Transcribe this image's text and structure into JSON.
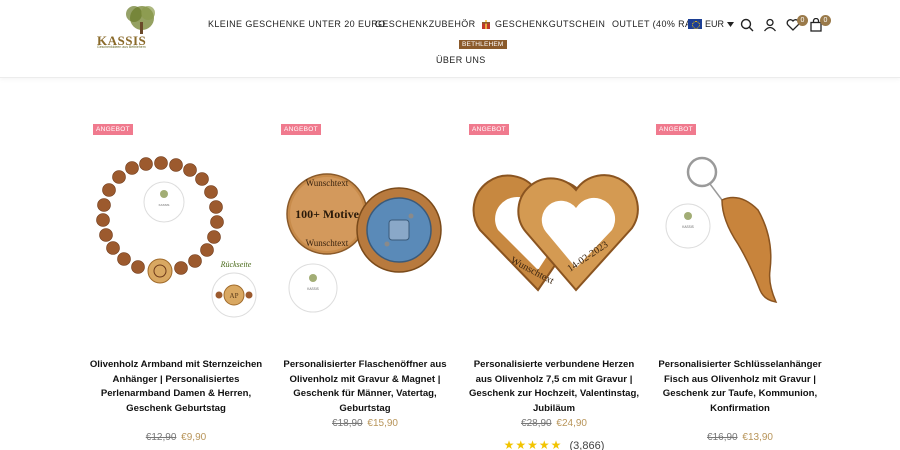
{
  "header": {
    "logo_text": "KASSIS",
    "logo_tagline": "Geschenkideen aus Bethlehem",
    "nav": [
      {
        "label": "KLEINE GESCHENKE UNTER 20 EURO"
      },
      {
        "label": "GESCHENKZUBEHÖR"
      },
      {
        "label": "GESCHENKGUTSCHEIN"
      },
      {
        "label": "OUTLET (40% RABATT)"
      },
      {
        "label": "ÜBER UNS"
      }
    ],
    "bethlehem_badge": "BETHLEHEM",
    "currency": "EUR",
    "wishlist_count": "0",
    "cart_count": "0",
    "icons": [
      "eu-flag-icon",
      "chevron-down-icon",
      "search-icon",
      "user-icon",
      "heart-icon",
      "bag-icon",
      "gift-icon"
    ]
  },
  "products": [
    {
      "badge": "ANGEBOT",
      "title": "Olivenholz Armband mit Sternzeichen Anhänger | Personalisiertes Perlenarmband Damen & Herren, Geschenk Geburtstag",
      "old_price": "€12,90",
      "new_price": "€9,90",
      "image_label": "Rückseite"
    },
    {
      "badge": "ANGEBOT",
      "title": "Personalisierter Flaschenöffner aus Olivenholz mit Gravur & Magnet | Geschenk für Männer, Vatertag, Geburtstag",
      "old_price": "€18,90",
      "new_price": "€15,90",
      "image_text_top": "Wunschtext",
      "image_text_mid": "100+ Motive",
      "image_text_bottom": "Wunschtext"
    },
    {
      "badge": "ANGEBOT",
      "title": "Personalisierte verbundene Herzen aus Olivenholz 7,5 cm mit Gravur | Geschenk zur Hochzeit, Valentinstag, Jubiläum",
      "old_price": "€28,90",
      "new_price": "€24,90",
      "image_text_left": "Wunschtext",
      "image_text_right": "14-02-2023",
      "rating_stars": 5,
      "rating_count": "(3,866)"
    },
    {
      "badge": "ANGEBOT",
      "title": "Personalisierter Schlüsselanhänger Fisch aus Olivenholz mit Gravur | Geschenk zur Taufe, Kommunion, Konfirmation",
      "old_price": "€16,90",
      "new_price": "€13,90"
    }
  ],
  "colors": {
    "sale_badge": "#f07a8e",
    "price_new": "#b8955a",
    "wood": "#b8803e",
    "count_bg": "#9a7a4a"
  }
}
